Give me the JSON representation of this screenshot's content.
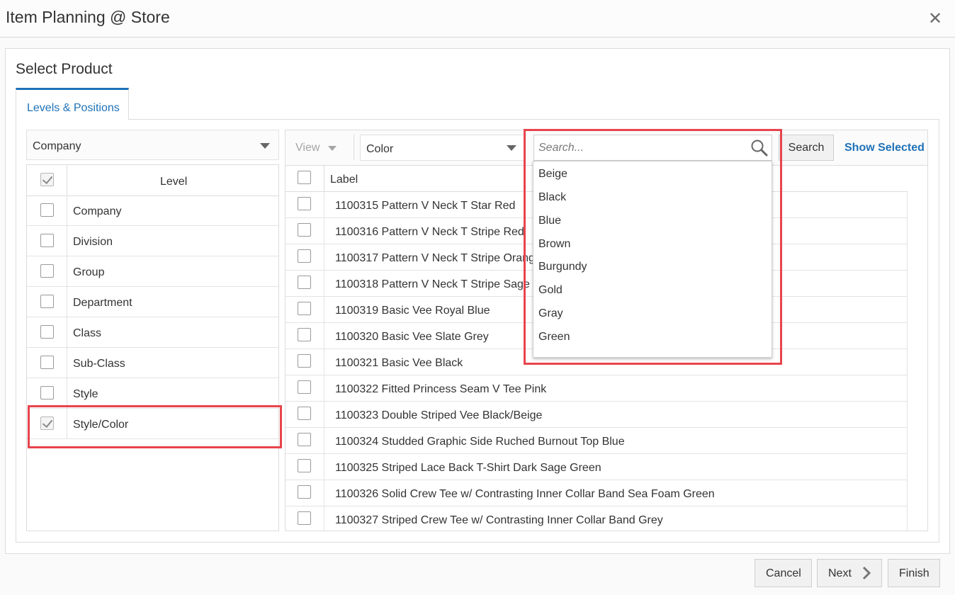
{
  "window": {
    "title": "Item Planning @ Store",
    "close_icon": "close-icon"
  },
  "panel": {
    "title": "Select Product"
  },
  "tabs": [
    {
      "label": "Levels & Positions",
      "active": true
    }
  ],
  "level_selector": {
    "value": "Company"
  },
  "level_table": {
    "header": "Level",
    "rows": [
      {
        "label": "Company",
        "checked": false
      },
      {
        "label": "Division",
        "checked": false
      },
      {
        "label": "Group",
        "checked": false
      },
      {
        "label": "Department",
        "checked": false
      },
      {
        "label": "Class",
        "checked": false
      },
      {
        "label": "Sub-Class",
        "checked": false
      },
      {
        "label": "Style",
        "checked": false
      },
      {
        "label": "Style/Color",
        "checked": true
      }
    ]
  },
  "toolbar": {
    "view_label": "View",
    "attribute_select": "Color",
    "search_placeholder": "Search...",
    "search_button": "Search",
    "show_selected": "Show Selected"
  },
  "item_table": {
    "header": "Label",
    "rows": [
      "1100315 Pattern V Neck T Star Red",
      "1100316 Pattern V Neck T Stripe Red",
      "1100317 Pattern V Neck T Stripe Orang",
      "1100318 Pattern V Neck T Stripe Sage C",
      "1100319 Basic Vee Royal Blue",
      "1100320 Basic Vee Slate Grey",
      "1100321 Basic Vee Black",
      "1100322 Fitted Princess Seam V Tee Pink",
      "1100323 Double Striped Vee Black/Beige",
      "1100324 Studded Graphic Side Ruched Burnout Top Blue",
      "1100325 Striped Lace Back T-Shirt Dark Sage Green",
      "1100326 Solid Crew Tee w/ Contrasting Inner Collar Band Sea Foam Green",
      "1100327 Striped Crew Tee w/ Contrasting Inner Collar Band Grey"
    ]
  },
  "color_dropdown": {
    "options": [
      "Beige",
      "Black",
      "Blue",
      "Brown",
      "Burgundy",
      "Gold",
      "Gray",
      "Green"
    ]
  },
  "footer": {
    "cancel": "Cancel",
    "next": "Next",
    "finish": "Finish"
  },
  "colors": {
    "accent": "#1f72b8",
    "highlight": "#e8444d"
  }
}
